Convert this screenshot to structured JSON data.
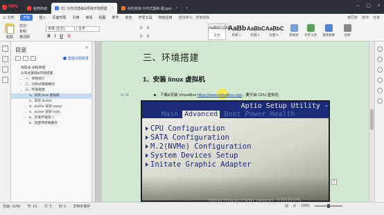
{
  "app": {
    "name": "WPS"
  },
  "tabs": [
    {
      "label": "稻壳商城",
      "color": "#e44d3a"
    },
    {
      "label": "01. 分布式基础&项目环境搭建",
      "color": "#3c7ce6"
    },
    {
      "label": "谷粒商城-分布式基础-图.pptx",
      "color": "#e8772e"
    }
  ],
  "menu": {
    "file": "三 文件",
    "items": [
      "开始",
      "插入",
      "页面布局",
      "引用",
      "审阅",
      "视图",
      "章节",
      "安全",
      "开发工具",
      "特色应用"
    ],
    "search": "查找命令、搜索模板",
    "right": [
      "未同步",
      "协作",
      "分享"
    ]
  },
  "ribbon": {
    "paste": "粘贴",
    "cut": "剪切",
    "copy": "复制",
    "format_painter": "格式刷",
    "font_name": "宋体 (正文)",
    "font_size": "五号",
    "styles": [
      {
        "preview": "AaBbCcDd",
        "label": "正文"
      },
      {
        "preview": "AaBb",
        "label": "标题 1"
      },
      {
        "preview": "AaBbC",
        "label": "标题 2"
      },
      {
        "preview": "AaBbC",
        "label": "标题 3"
      }
    ],
    "tools": [
      {
        "label": "新样式",
        "color": "#7aa0d8"
      },
      {
        "label": "文字工具",
        "color": "#5aa05a"
      },
      {
        "label": "查找替换",
        "color": "#4f86d6"
      },
      {
        "label": "选择",
        "color": "#888888"
      }
    ]
  },
  "nav": {
    "title": "目录",
    "smart": "智能识别目录",
    "items": [
      {
        "text": "尚硅谷-谷粒商城",
        "indent": 0,
        "arrow": ""
      },
      {
        "text": "分布式基础&环境搭建",
        "indent": 0,
        "arrow": ""
      },
      {
        "text": "一、项目简介",
        "indent": 1,
        "arrow": ">"
      },
      {
        "text": "二、分布式基础概念",
        "indent": 1,
        "arrow": ">"
      },
      {
        "text": "三、环境搭建",
        "indent": 1,
        "arrow": "v"
      },
      {
        "text": "1、安装 linux 虚拟机",
        "indent": 2,
        "arrow": "",
        "selected": true
      },
      {
        "text": "2、安装 docker",
        "indent": 2,
        "arrow": ""
      },
      {
        "text": "3、docker 安装 mysql",
        "indent": 2,
        "arrow": ">"
      },
      {
        "text": "4、docker 安装 redis",
        "indent": 2,
        "arrow": ">"
      },
      {
        "text": "5、开发环境统一",
        "indent": 2,
        "arrow": ">"
      },
      {
        "text": "6、创建项目微服务",
        "indent": 2,
        "arrow": ""
      }
    ]
  },
  "doc": {
    "h1": "三、环境搭建",
    "h2": "1、安装 linux 虚拟机",
    "bullet_prefix": "下载&安装 VirtualBox ",
    "bullet_link": "https://www.virtualbox.org/",
    "bullet_suffix": "，要开启 CPU 虚拟化"
  },
  "bios": {
    "title": "Aptio Setup Utility -",
    "tabs": [
      "Main",
      "Advanced",
      "Boot",
      "Power",
      "Health"
    ],
    "active_tab": "Advanced",
    "items": [
      "CPU Configuration",
      "SATA Configuration",
      "M.2(NVMe) Configuration",
      "System Devices Setup",
      "Initate Graphic Adapter"
    ]
  },
  "status": {
    "left": [
      "页面: 12/66",
      "节: 1/1",
      "行: 5",
      "列: 5",
      "文档未保护"
    ],
    "zoom": "100%"
  },
  "watermark": "https://blog.csdn.net/qq_1707025"
}
